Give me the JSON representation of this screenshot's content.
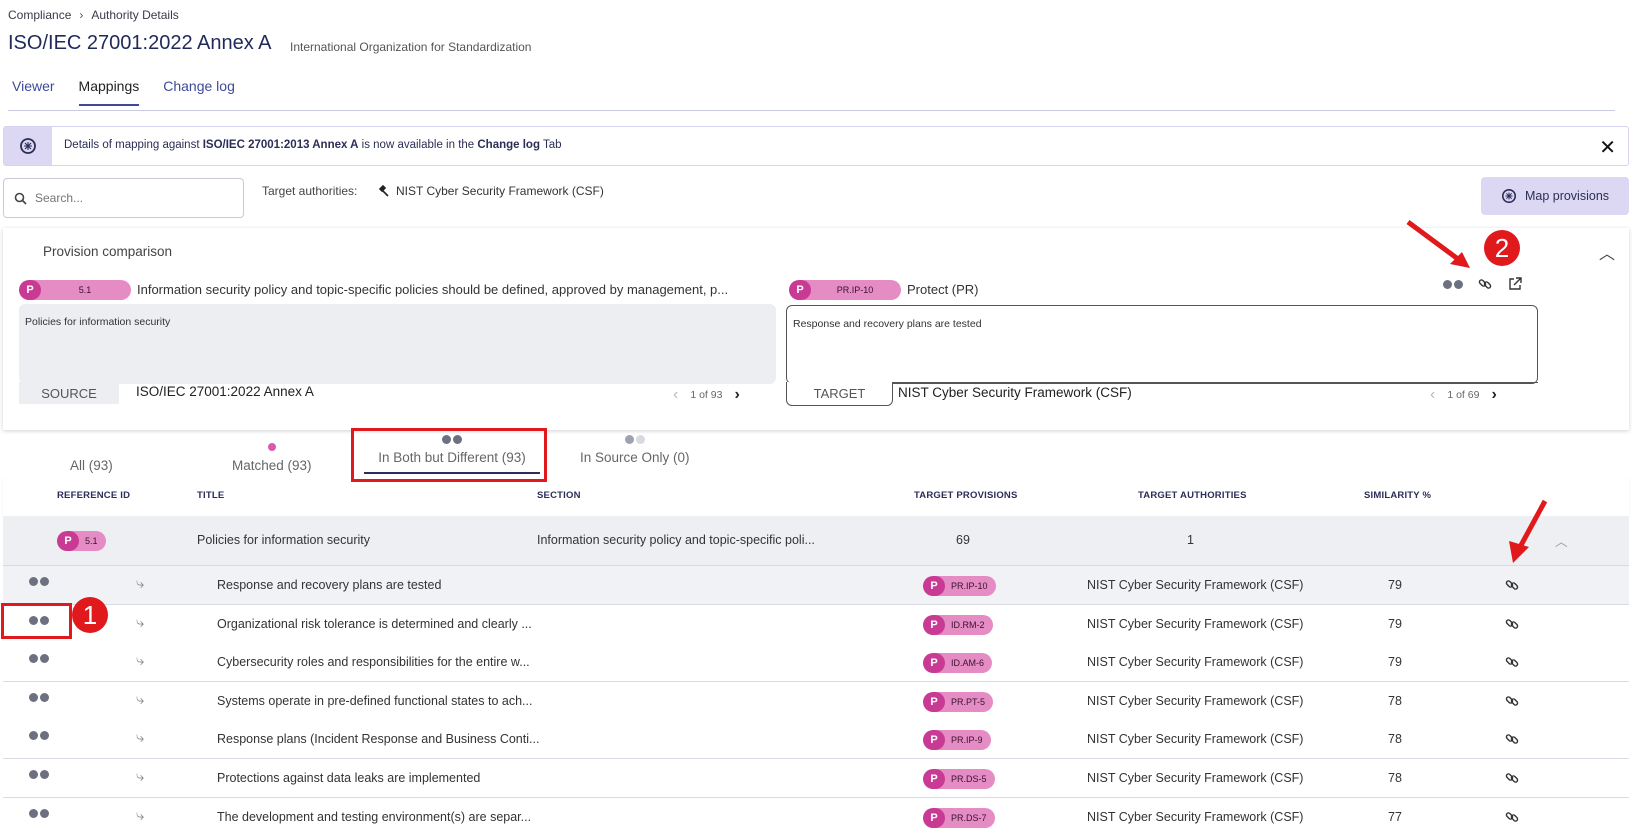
{
  "breadcrumb": {
    "root": "Compliance",
    "current": "Authority Details"
  },
  "header": {
    "title": "ISO/IEC 27001:2022 Annex A",
    "subtitle": "International Organization for Standardization"
  },
  "tabs": [
    {
      "label": "Viewer"
    },
    {
      "label": "Mappings"
    },
    {
      "label": "Change log"
    }
  ],
  "banner": {
    "text_1": "Details of mapping against ",
    "bold_1": "ISO/IEC 27001:2013 Annex A",
    "text_2": " is now available in the ",
    "bold_2": "Change log",
    "text_3": " Tab"
  },
  "search": {
    "placeholder": "Search..."
  },
  "target_authorities": {
    "label": "Target authorities:",
    "value": "NIST Cyber Security Framework (CSF)"
  },
  "map_button": {
    "label": "Map provisions"
  },
  "comparison": {
    "title": "Provision comparison",
    "source": {
      "badge_letter": "P",
      "code": "5.1",
      "heading": "Information security policy and topic-specific policies should be defined, approved by management, p...",
      "body": "Policies for information security",
      "label": "SOURCE",
      "authority": "ISO/IEC 27001:2022 Annex A",
      "pager": "1 of 93"
    },
    "target": {
      "badge_letter": "P",
      "code": "PR.IP-10",
      "heading": "Protect (PR)",
      "body": "Response and recovery plans are tested",
      "label": "TARGET",
      "authority": "NIST Cyber Security Framework (CSF)",
      "pager": "1 of 69"
    }
  },
  "filters": [
    {
      "label": "All (93)"
    },
    {
      "label": "Matched (93)"
    },
    {
      "label": "In Both but Different (93)"
    },
    {
      "label": "In Source Only (0)"
    }
  ],
  "table": {
    "headers": [
      "REFERENCE ID",
      "TITLE",
      "SECTION",
      "TARGET PROVISIONS",
      "TARGET AUTHORITIES",
      "SIMILARITY %"
    ],
    "group": {
      "badge_letter": "P",
      "code": "5.1",
      "title": "Policies for information security",
      "section": "Information security policy and topic-specific poli...",
      "target_provisions": "69",
      "target_authorities": "1"
    },
    "rows": [
      {
        "title": "Response and recovery plans are tested",
        "badge_letter": "P",
        "code": "PR.IP-10",
        "authority": "NIST Cyber Security Framework (CSF)",
        "similarity": "79"
      },
      {
        "title": "Organizational risk tolerance is determined and clearly ...",
        "badge_letter": "P",
        "code": "ID.RM-2",
        "authority": "NIST Cyber Security Framework (CSF)",
        "similarity": "79"
      },
      {
        "title": "Cybersecurity roles and responsibilities for the entire w...",
        "badge_letter": "P",
        "code": "ID.AM-6",
        "authority": "NIST Cyber Security Framework (CSF)",
        "similarity": "79"
      },
      {
        "title": "Systems operate in pre-defined functional states to ach...",
        "badge_letter": "P",
        "code": "PR.PT-5",
        "authority": "NIST Cyber Security Framework (CSF)",
        "similarity": "78"
      },
      {
        "title": "Response plans (Incident Response and Business Conti...",
        "badge_letter": "P",
        "code": "PR.IP-9",
        "authority": "NIST Cyber Security Framework (CSF)",
        "similarity": "78"
      },
      {
        "title": "Protections against data leaks are implemented",
        "badge_letter": "P",
        "code": "PR.DS-5",
        "authority": "NIST Cyber Security Framework (CSF)",
        "similarity": "78"
      },
      {
        "title": "The development and testing environment(s) are separ...",
        "badge_letter": "P",
        "code": "PR.DS-7",
        "authority": "NIST Cyber Security Framework (CSF)",
        "similarity": "77"
      }
    ]
  },
  "annotations": {
    "badge_1": "1",
    "badge_2": "2"
  },
  "colors": {
    "accent": "#3d4a9a",
    "pill_bg": "#e58cc4",
    "pill_letter_bg": "#c83a93",
    "annotation_red": "#e0191c",
    "banner_icon_bg": "#dcd8f3"
  }
}
